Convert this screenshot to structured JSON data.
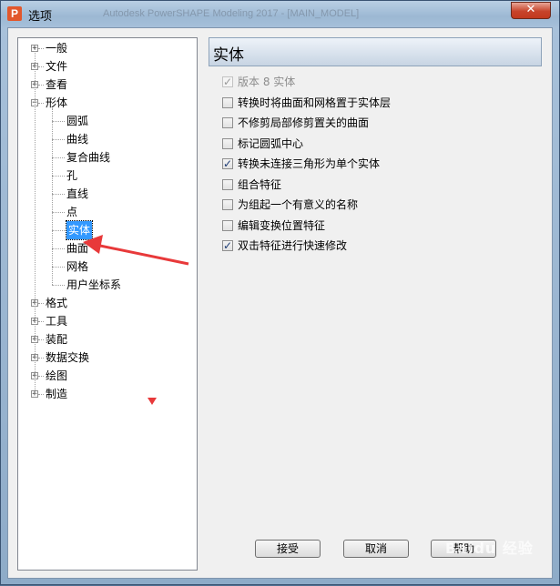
{
  "window": {
    "title": "选项",
    "app_icon_letter": "P",
    "background_title": "Autodesk PowerSHAPE Modeling 2017 - [MAIN_MODEL]",
    "close_glyph": "✕"
  },
  "tree": {
    "items": [
      {
        "label": "一般",
        "expander": "+"
      },
      {
        "label": "文件",
        "expander": "+"
      },
      {
        "label": "查看",
        "expander": "+"
      },
      {
        "label": "形体",
        "expander": "−"
      },
      {
        "label": "圆弧"
      },
      {
        "label": "曲线"
      },
      {
        "label": "复合曲线"
      },
      {
        "label": "孔"
      },
      {
        "label": "直线"
      },
      {
        "label": "点"
      },
      {
        "label": "实体",
        "selected": true
      },
      {
        "label": "曲面"
      },
      {
        "label": "网格"
      },
      {
        "label": "用户坐标系"
      },
      {
        "label": "格式",
        "expander": "+"
      },
      {
        "label": "工具",
        "expander": "+"
      },
      {
        "label": "装配",
        "expander": "+"
      },
      {
        "label": "数据交换",
        "expander": "+"
      },
      {
        "label": "绘图",
        "expander": "+"
      },
      {
        "label": "制造",
        "expander": "+"
      }
    ]
  },
  "panel": {
    "title": "实体",
    "options": [
      {
        "label": "版本 8 实体",
        "checked": true,
        "disabled": true
      },
      {
        "label": "转换时将曲面和网格置于实体层",
        "checked": false
      },
      {
        "label": "不修剪局部修剪置关的曲面",
        "checked": false
      },
      {
        "label": "标记圆弧中心",
        "checked": false
      },
      {
        "label": "转换未连接三角形为单个实体",
        "checked": true
      },
      {
        "label": "组合特征",
        "checked": false
      },
      {
        "label": "为组起一个有意义的名称",
        "checked": false
      },
      {
        "label": "编辑变换位置特征",
        "checked": false
      },
      {
        "label": "双击特征进行快速修改",
        "checked": true
      }
    ]
  },
  "buttons": {
    "accept": "接受",
    "cancel": "取消",
    "help": "帮助"
  },
  "watermark": "Baidu 经验",
  "colors": {
    "selection": "#3399ff",
    "annotation": "#e8393a"
  }
}
